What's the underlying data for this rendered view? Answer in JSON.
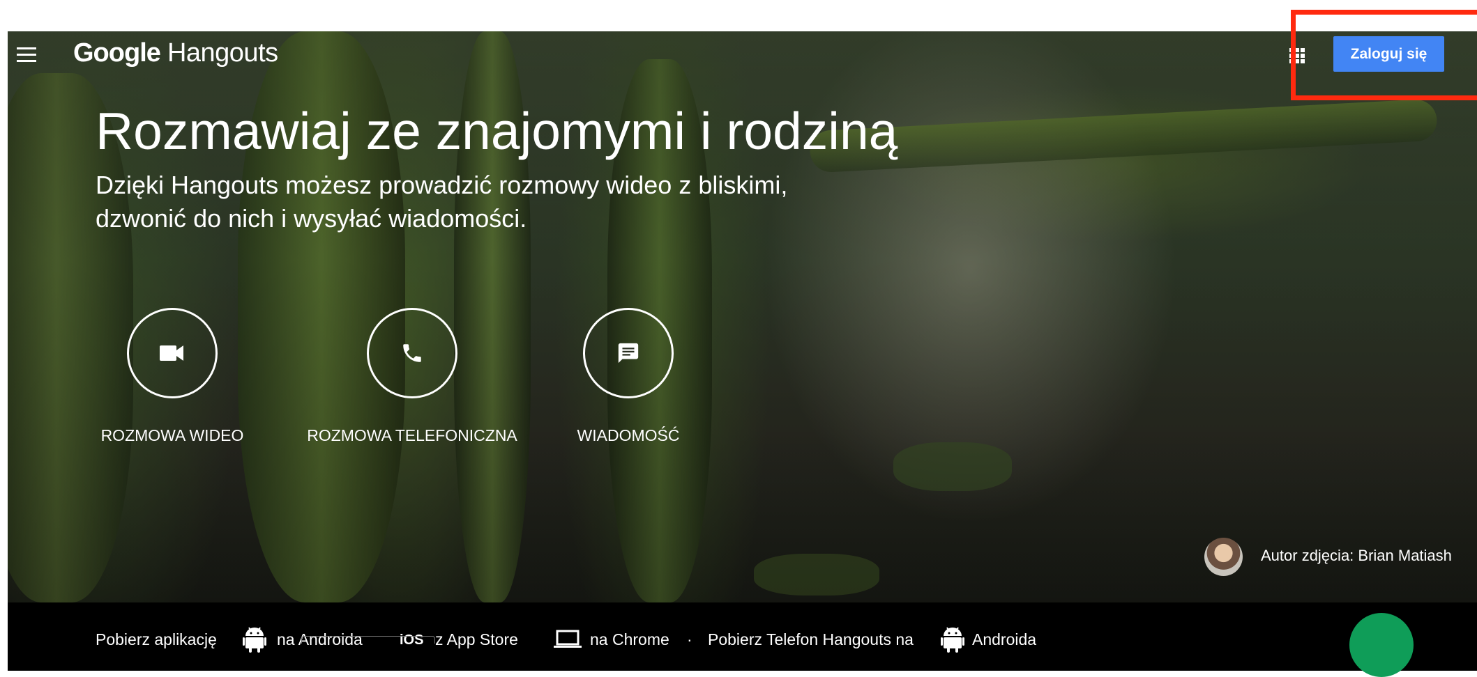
{
  "header": {
    "logo_google": "Google",
    "logo_product": "Hangouts",
    "signin_label": "Zaloguj się"
  },
  "hero": {
    "headline": "Rozmawiaj ze znajomymi i rodziną",
    "subline_1": "Dzięki Hangouts możesz prowadzić rozmowy wideo z bliskimi,",
    "subline_2": "dzwonić do nich i wysyłać wiadomości."
  },
  "actions": [
    {
      "label": "ROZMOWA WIDEO",
      "icon": "videocam-icon"
    },
    {
      "label": "ROZMOWA TELEFONICZNA",
      "icon": "phone-icon"
    },
    {
      "label": "WIADOMOŚĆ",
      "icon": "message-icon"
    }
  ],
  "credit": {
    "text": "Autor zdjęcia: Brian Matiash"
  },
  "footer": {
    "get_app": "Pobierz aplikację",
    "android": "na Androida",
    "ios_badge": "iOS",
    "app_store": "z App Store",
    "chrome": "na Chrome",
    "separator": "·",
    "dialer": "Pobierz Telefon Hangouts na",
    "android2": "Androida"
  },
  "colors": {
    "signin": "#4285f4",
    "highlight": "#ff2a0f",
    "fab": "#0f9d58",
    "footer": "#000000"
  }
}
